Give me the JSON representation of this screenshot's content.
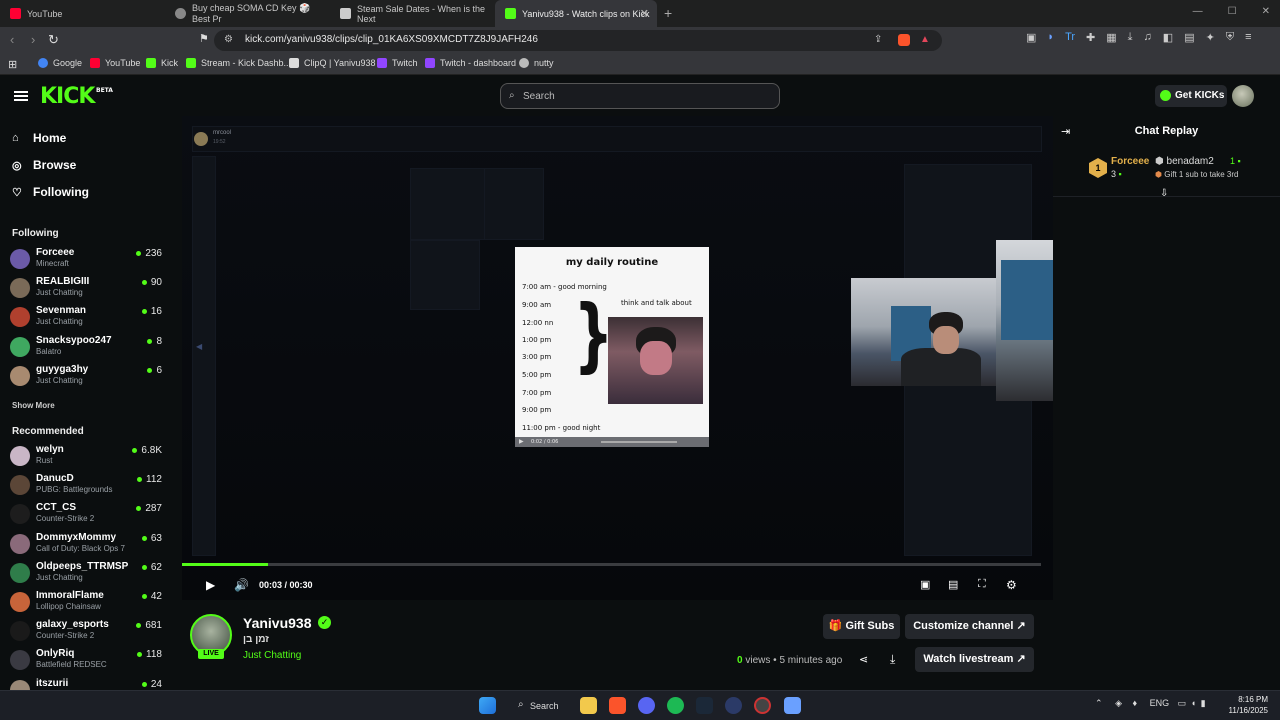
{
  "browser": {
    "tabs": [
      {
        "title": "YouTube",
        "color": "#ff0033"
      },
      {
        "title": "Buy cheap SOMA CD Key 🎲 Best Pr",
        "color": "#888888"
      },
      {
        "title": "Steam Sale Dates - When is the Next",
        "color": "#cccccc"
      },
      {
        "title": "Yanivu938 - Watch clips on Kick",
        "color": "#53fc18",
        "close": "✕"
      }
    ],
    "new_tab": "+",
    "url": "kick.com/yanivu938/clips/clip_01KA6XS09XMCDT7Z8J9JAFH246",
    "bookmarks": [
      {
        "label": "Google",
        "color": "#4285f4"
      },
      {
        "label": "YouTube",
        "color": "#ff0033"
      },
      {
        "label": "Kick",
        "color": "#53fc18"
      },
      {
        "label": "Stream - Kick Dashb...",
        "color": "#53fc18"
      },
      {
        "label": "ClipQ | Yanivu938",
        "color": "#dddddd"
      },
      {
        "label": "Twitch",
        "color": "#9146ff"
      },
      {
        "label": "Twitch - dashboard",
        "color": "#9146ff"
      },
      {
        "label": "nutty",
        "color": "#bbbbbb"
      }
    ]
  },
  "header": {
    "logo": "KICK",
    "logo_tag": "BETA",
    "search_placeholder": "Search",
    "get_kicks": "Get KICKs"
  },
  "sidebar": {
    "nav": [
      {
        "label": "Home",
        "icon": "home-icon"
      },
      {
        "label": "Browse",
        "icon": "compass-icon"
      },
      {
        "label": "Following",
        "icon": "heart-icon"
      }
    ],
    "following_title": "Following",
    "following": [
      {
        "name": "Forceee",
        "game": "Minecraft",
        "viewers": "236",
        "color": "#6b5aa8"
      },
      {
        "name": "REALBIGIII",
        "game": "Just Chatting",
        "viewers": "90",
        "color": "#7a6a58"
      },
      {
        "name": "Sevenman",
        "game": "Just Chatting",
        "viewers": "16",
        "color": "#b0402e"
      },
      {
        "name": "Snacksypoo247",
        "game": "Balatro",
        "viewers": "8",
        "color": "#3fa860"
      },
      {
        "name": "guyyga3hy",
        "game": "Just Chatting",
        "viewers": "6",
        "color": "#a88a70"
      }
    ],
    "show_more": "Show More",
    "recommended_title": "Recommended",
    "recommended": [
      {
        "name": "welyn",
        "game": "Rust",
        "viewers": "6.8K",
        "color": "#c9b6c6"
      },
      {
        "name": "DanucD",
        "game": "PUBG: Battlegrounds",
        "viewers": "112",
        "color": "#5b4637"
      },
      {
        "name": "CCT_CS",
        "game": "Counter-Strike 2",
        "viewers": "287",
        "color": "#1d1d1d"
      },
      {
        "name": "DommyxMommy",
        "game": "Call of Duty: Black Ops 7",
        "viewers": "63",
        "color": "#8a6a7a"
      },
      {
        "name": "Oldpeeps_TTRMSP",
        "game": "Just Chatting",
        "viewers": "62",
        "color": "#2f7d4a"
      },
      {
        "name": "ImmoralFlame",
        "game": "Lollipop Chainsaw",
        "viewers": "42",
        "color": "#c7643a"
      },
      {
        "name": "galaxy_esports",
        "game": "Counter-Strike 2",
        "viewers": "681",
        "color": "#1a1a1a"
      },
      {
        "name": "OnlyRiq",
        "game": "Battlefield REDSEC",
        "viewers": "118",
        "color": "#3a3a42"
      },
      {
        "name": "itszurii",
        "game": "",
        "viewers": "24",
        "color": "#998877"
      }
    ]
  },
  "player": {
    "meme_title": "my daily routine",
    "meme_rows": [
      "7:00 am - good morning",
      "9:00 am",
      "12:00 nn",
      "1:00 pm",
      "3:00 pm",
      "5:00 pm",
      "7:00 pm",
      "9:00 pm",
      "11:00 pm - good night"
    ],
    "meme_side": "think and talk about",
    "meme_brace": "}",
    "meme_time": "0:02 / 0:06",
    "stream_user": "mrcool",
    "stream_sub": "19:52",
    "progress": 0.1,
    "time": "00:03 / 00:30"
  },
  "channel": {
    "name": "Yanivu938",
    "clip_title": "זמן בן",
    "category": "Just Chatting",
    "live": "LIVE",
    "views_count": "0",
    "views_label": "views",
    "sep": "•",
    "ago": "5 minutes ago",
    "gift_subs": "Gift Subs",
    "customize": "Customize channel",
    "watch": "Watch livestream"
  },
  "chat": {
    "title": "Chat Replay",
    "top_gifter": {
      "rank": "1",
      "name": "Forceee",
      "count": "3"
    },
    "second": {
      "name": "benadam2",
      "count": "1"
    },
    "prompt": "Gift 1 sub to take 3rd"
  },
  "taskbar": {
    "search": "Search",
    "lang": "ENG",
    "time": "8:16 PM",
    "date": "11/16/2025"
  },
  "colors": {
    "accent": "#53fc18",
    "bg": "#0b0e0f",
    "gold": "#e3b04b"
  }
}
